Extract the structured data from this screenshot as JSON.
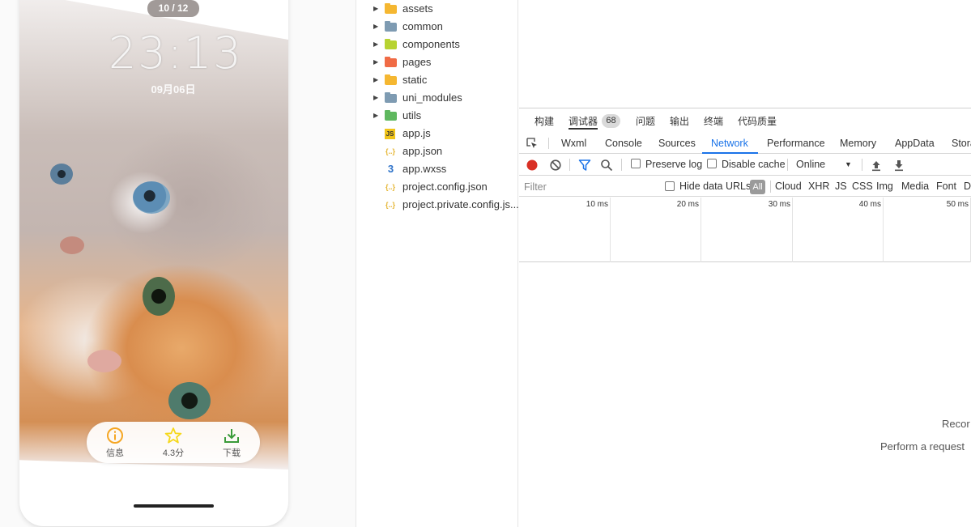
{
  "simulator": {
    "counter": "10 / 12",
    "clock": "23:13",
    "date": "09月06日",
    "actions": [
      {
        "label": "信息",
        "icon": "info-icon",
        "color": "#f5a623"
      },
      {
        "label": "4.3分",
        "icon": "star-icon",
        "color": "#f5d81b"
      },
      {
        "label": "下载",
        "icon": "download-icon",
        "color": "#3a9b3a"
      }
    ]
  },
  "file_tree": {
    "items": [
      {
        "name": "assets",
        "type": "folder",
        "icon": "folder-icon",
        "color": "#f5b731"
      },
      {
        "name": "common",
        "type": "folder",
        "icon": "folder-icon",
        "color": "#7e9bb2"
      },
      {
        "name": "components",
        "type": "folder",
        "icon": "components-folder-icon",
        "color": "#b7d331"
      },
      {
        "name": "pages",
        "type": "folder",
        "icon": "pages-folder-icon",
        "color": "#f06b45"
      },
      {
        "name": "static",
        "type": "folder",
        "icon": "folder-icon",
        "color": "#f5b731"
      },
      {
        "name": "uni_modules",
        "type": "folder",
        "icon": "folder-icon",
        "color": "#7e9bb2"
      },
      {
        "name": "utils",
        "type": "folder",
        "icon": "utils-folder-icon",
        "color": "#5fb85f"
      },
      {
        "name": "app.js",
        "type": "file",
        "icon": "js-file-icon",
        "color": "#f0c419"
      },
      {
        "name": "app.json",
        "type": "file",
        "icon": "json-file-icon",
        "color": "#e5b533"
      },
      {
        "name": "app.wxss",
        "type": "file",
        "icon": "css-file-icon",
        "color": "#2f73c9"
      },
      {
        "name": "project.config.json",
        "type": "file",
        "icon": "json-file-icon",
        "color": "#e5b533"
      },
      {
        "name": "project.private.config.js...",
        "type": "file",
        "icon": "json-file-icon",
        "color": "#e5b533"
      }
    ]
  },
  "devtools": {
    "panel_tabs": [
      "构建",
      "调试器",
      "问题",
      "输出",
      "终端",
      "代码质量"
    ],
    "debugger_badge": "68",
    "tabs": [
      "Wxml",
      "Console",
      "Sources",
      "Network",
      "Performance",
      "Memory",
      "AppData",
      "Stora"
    ],
    "active_tab": "Network",
    "toolbar": {
      "preserve_log": "Preserve log",
      "disable_cache": "Disable cache",
      "throttling": "Online"
    },
    "filter": {
      "placeholder": "Filter",
      "hide_data_urls": "Hide data URLs",
      "types": [
        "All",
        "Cloud",
        "XHR",
        "JS",
        "CSS",
        "Img",
        "Media",
        "Font",
        "D"
      ]
    },
    "timeline_ticks": [
      "10 ms",
      "20 ms",
      "30 ms",
      "40 ms",
      "50 ms"
    ],
    "empty_state": {
      "line1": "Recor",
      "line2": "Perform a request"
    },
    "colors": {
      "accent": "#1a73e8",
      "record": "#d93025"
    }
  }
}
